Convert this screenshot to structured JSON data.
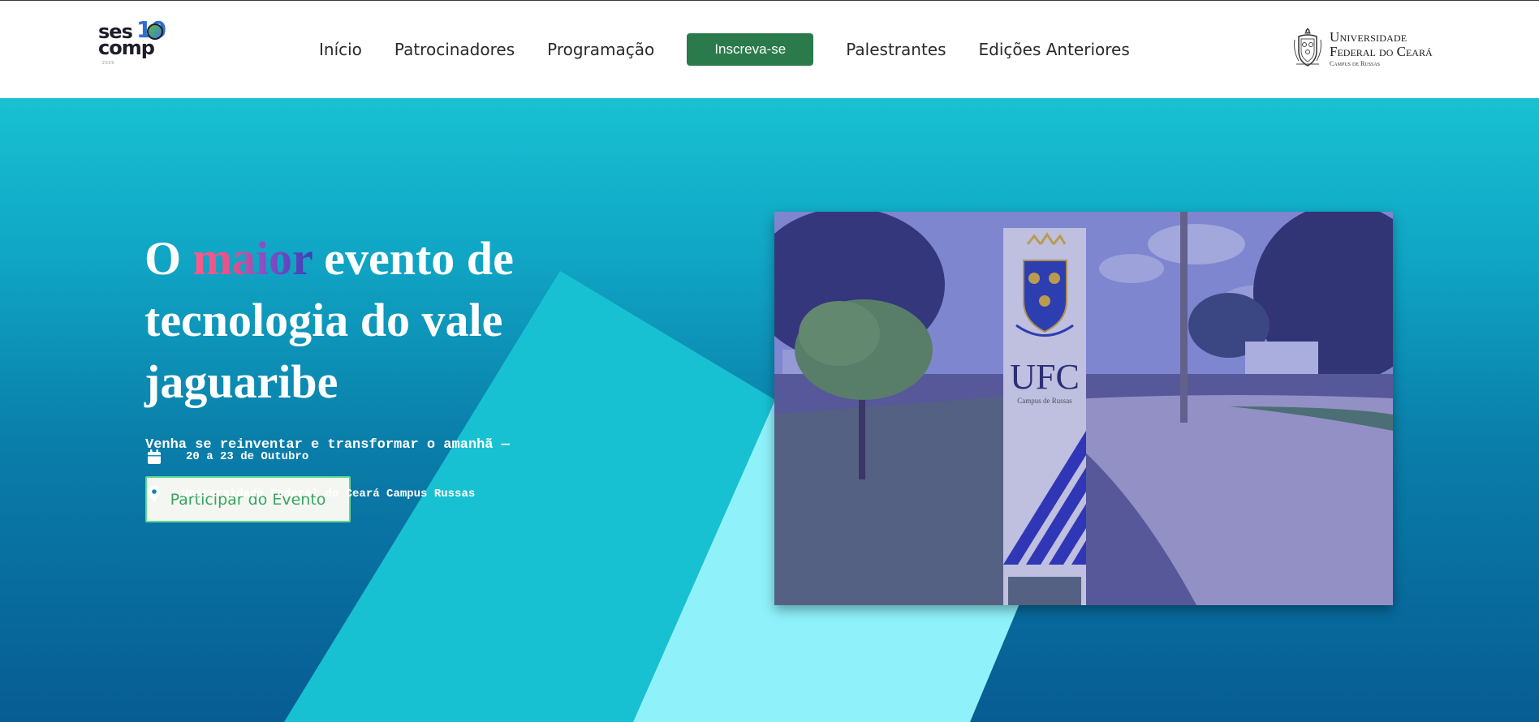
{
  "header": {
    "logo": {
      "line1": "ses",
      "line2": "comp",
      "number": "10",
      "year": "2025"
    },
    "nav": [
      {
        "label": "Início"
      },
      {
        "label": "Patrocinadores"
      },
      {
        "label": "Programação"
      },
      {
        "label": "Inscreva-se"
      },
      {
        "label": "Palestrantes"
      },
      {
        "label": "Edições Anteriores"
      }
    ],
    "university": {
      "line1": "Universidade",
      "line2": "Federal do Ceará",
      "line3": "Campus de Russas"
    }
  },
  "hero": {
    "headline_o": "O ",
    "headline_highlight": "maior",
    "headline_rest": " evento de tecnologia do vale jaguaribe",
    "subtitle": "Venha se reinventar e transformar o amanhã —",
    "button_label": "Participar do Evento",
    "date": "20 a 23 de Outubro",
    "location": "Universidade Federal do Ceará Campus Russas"
  },
  "photo": {
    "sign_text": "UFC",
    "sign_sub": "Campus de Russas"
  },
  "colors": {
    "primary_button": "#2b7a4b",
    "hero_top": "#18c1d2",
    "hero_bottom": "#075c93",
    "accent_green": "#37a461",
    "photo_overlay": "#3b3fb0"
  }
}
